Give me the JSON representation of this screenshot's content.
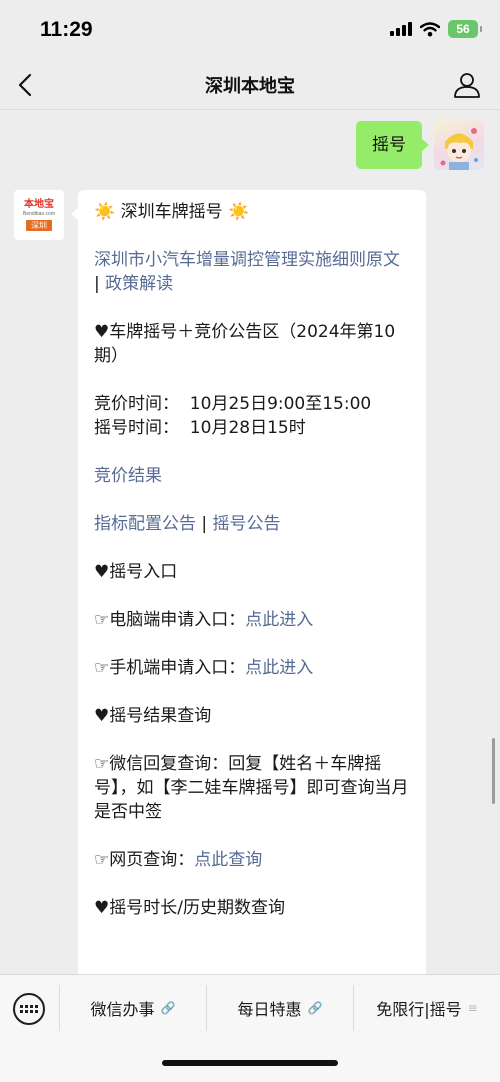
{
  "status_bar": {
    "time": "11:29",
    "battery": "56"
  },
  "nav": {
    "title": "深圳本地宝"
  },
  "user_message": {
    "text": "摇号"
  },
  "brand_avatar": {
    "name": "本地宝",
    "url": "Bendibao.com",
    "city": "深圳"
  },
  "reply": {
    "sun_icon": "☀️",
    "title": "深圳车牌摇号",
    "rules_link": "深圳市小汽车增量调控管理实施细则原文",
    "separator": " | ",
    "policy_link": "政策解读",
    "heart": "♥",
    "notice_heading": "车牌摇号＋竞价公告区（2024年第10期）",
    "bid_time": "竞价时间：  10月25日9:00至15:00",
    "lottery_time": "摇号时间：  10月28日15时",
    "bid_result_link": "竞价结果",
    "quota_link": "指标配置公告",
    "lottery_notice_link": "摇号公告",
    "entry_heading": "摇号入口",
    "pointer": "☞",
    "pc_entry_label": "电脑端申请入口：",
    "pc_entry_link": "点此进入",
    "mobile_entry_label": "手机端申请入口：",
    "mobile_entry_link": "点此进入",
    "result_heading": "摇号结果查询",
    "wechat_query": "微信回复查询：回复【姓名＋车牌摇号】，如【李二娃车牌摇号】即可查询当月是否中签",
    "web_query_label": "网页查询：",
    "web_query_link": "点此查询",
    "history_heading": "摇号时长/历史期数查询"
  },
  "bottom_menu": {
    "item1": "微信办事",
    "item2": "每日特惠",
    "item3": "免限行|摇号",
    "link_glyph": "🔗",
    "list_glyph": "≡"
  }
}
